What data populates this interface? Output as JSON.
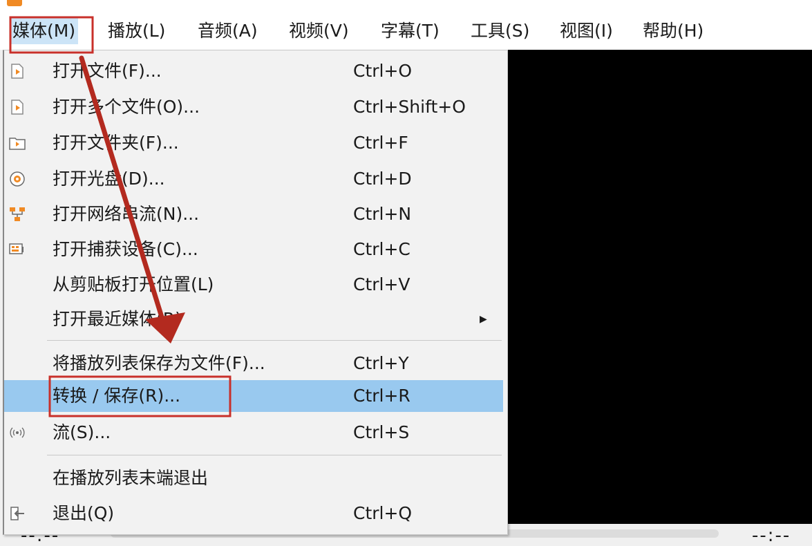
{
  "menubar": {
    "items": [
      {
        "label": "媒体(M)",
        "active": true
      },
      {
        "label": "播放(L)"
      },
      {
        "label": "音频(A)"
      },
      {
        "label": "视频(V)"
      },
      {
        "label": "字幕(T)"
      },
      {
        "label": "工具(S)"
      },
      {
        "label": "视图(I)"
      },
      {
        "label": "帮助(H)"
      }
    ]
  },
  "media_menu": {
    "items": [
      {
        "label": "打开文件(F)...",
        "shortcut": "Ctrl+O",
        "icon": "open-file-icon"
      },
      {
        "label": "打开多个文件(O)...",
        "shortcut": "Ctrl+Shift+O",
        "icon": "open-multiple-files-icon"
      },
      {
        "label": "打开文件夹(F)...",
        "shortcut": "Ctrl+F",
        "icon": "open-folder-icon"
      },
      {
        "label": "打开光盘(D)...",
        "shortcut": "Ctrl+D",
        "icon": "disc-icon"
      },
      {
        "label": "打开网络串流(N)...",
        "shortcut": "Ctrl+N",
        "icon": "network-icon"
      },
      {
        "label": "打开捕获设备(C)...",
        "shortcut": "Ctrl+C",
        "icon": "capture-device-icon"
      },
      {
        "label": "从剪贴板打开位置(L)",
        "shortcut": "Ctrl+V"
      },
      {
        "label": "打开最近媒体(R)",
        "shortcut": "",
        "submenu": true
      },
      {
        "label": "将播放列表保存为文件(F)...",
        "shortcut": "Ctrl+Y"
      },
      {
        "label": "转换 / 保存(R)...",
        "shortcut": "Ctrl+R",
        "highlighted": true
      },
      {
        "label": "流(S)...",
        "shortcut": "Ctrl+S",
        "icon": "stream-icon"
      },
      {
        "label": "在播放列表末端退出",
        "shortcut": ""
      },
      {
        "label": "退出(Q)",
        "shortcut": "Ctrl+Q",
        "icon": "exit-icon"
      }
    ]
  },
  "statusbar": {
    "elapsed": "--:--",
    "total": "--:--"
  },
  "annotation": {
    "box_color": "#c8302a",
    "arrow_color": "#b32a1f"
  },
  "colors": {
    "highlight": "#99c9ef",
    "menu_bg": "#f2f2f2",
    "video_bg": "#000000"
  }
}
